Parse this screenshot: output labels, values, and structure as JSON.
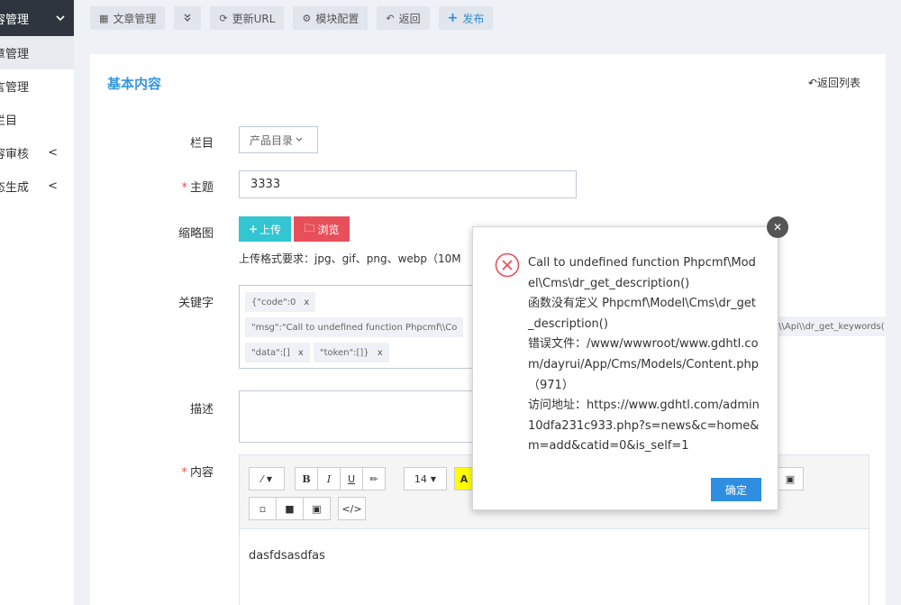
{
  "sidebar": {
    "header_label": "容管理",
    "items": [
      {
        "label": "章管理",
        "chevron": ""
      },
      {
        "label": "言管理",
        "chevron": ""
      },
      {
        "label": "栏目",
        "chevron": ""
      },
      {
        "label": "容审核",
        "chevron": "<"
      },
      {
        "label": "态生成",
        "chevron": "<"
      }
    ]
  },
  "toolbar": {
    "article_manage": "文章管理",
    "update_url": "更新URL",
    "module_config": "模块配置",
    "back": "返回",
    "publish": "发布"
  },
  "card": {
    "title": "基本内容",
    "back_list": "返回列表"
  },
  "form": {
    "column_label": "栏目",
    "column_value": "产品目录",
    "subject_label": "主题",
    "subject_value": "3333",
    "thumb_label": "缩略图",
    "upload_btn": "上传",
    "browse_btn": "浏览",
    "upload_hint": "上传格式要求：jpg、gif、png、webp（10M",
    "keyword_label": "关键字",
    "tags": [
      "{\"code\":0",
      "\"msg\":\"Call to undefined function Phpcmf\\\\Co",
      "\"data\":[]",
      "\"token\":[]}"
    ],
    "tag_overflow": "pl\\\\Api\\\\dr_get_keywords(",
    "desc_label": "描述",
    "content_label": "内容",
    "content_text": "dasfdsasdfas",
    "font_size": "14"
  },
  "dialog": {
    "lines": [
      "Call to undefined function Phpcmf\\Model\\Cms\\dr_get_description()",
      "函数没有定义 Phpcmf\\Model\\Cms\\dr_get_description()",
      "错误文件：/www/wwwroot/www.gdhtl.com/dayrui/App/Cms/Models/Content.php（971）",
      "访问地址：https://www.gdhtl.com/admin10dfa231c933.php?s=news&c=home&m=add&catid=0&is_self=1"
    ],
    "ok_label": "确定"
  },
  "colors": {
    "accent": "#3598dc",
    "danger": "#e7505a",
    "info": "#32c5d2",
    "primary_btn": "#2f8ee0",
    "sidebar_header": "#2f353f"
  }
}
